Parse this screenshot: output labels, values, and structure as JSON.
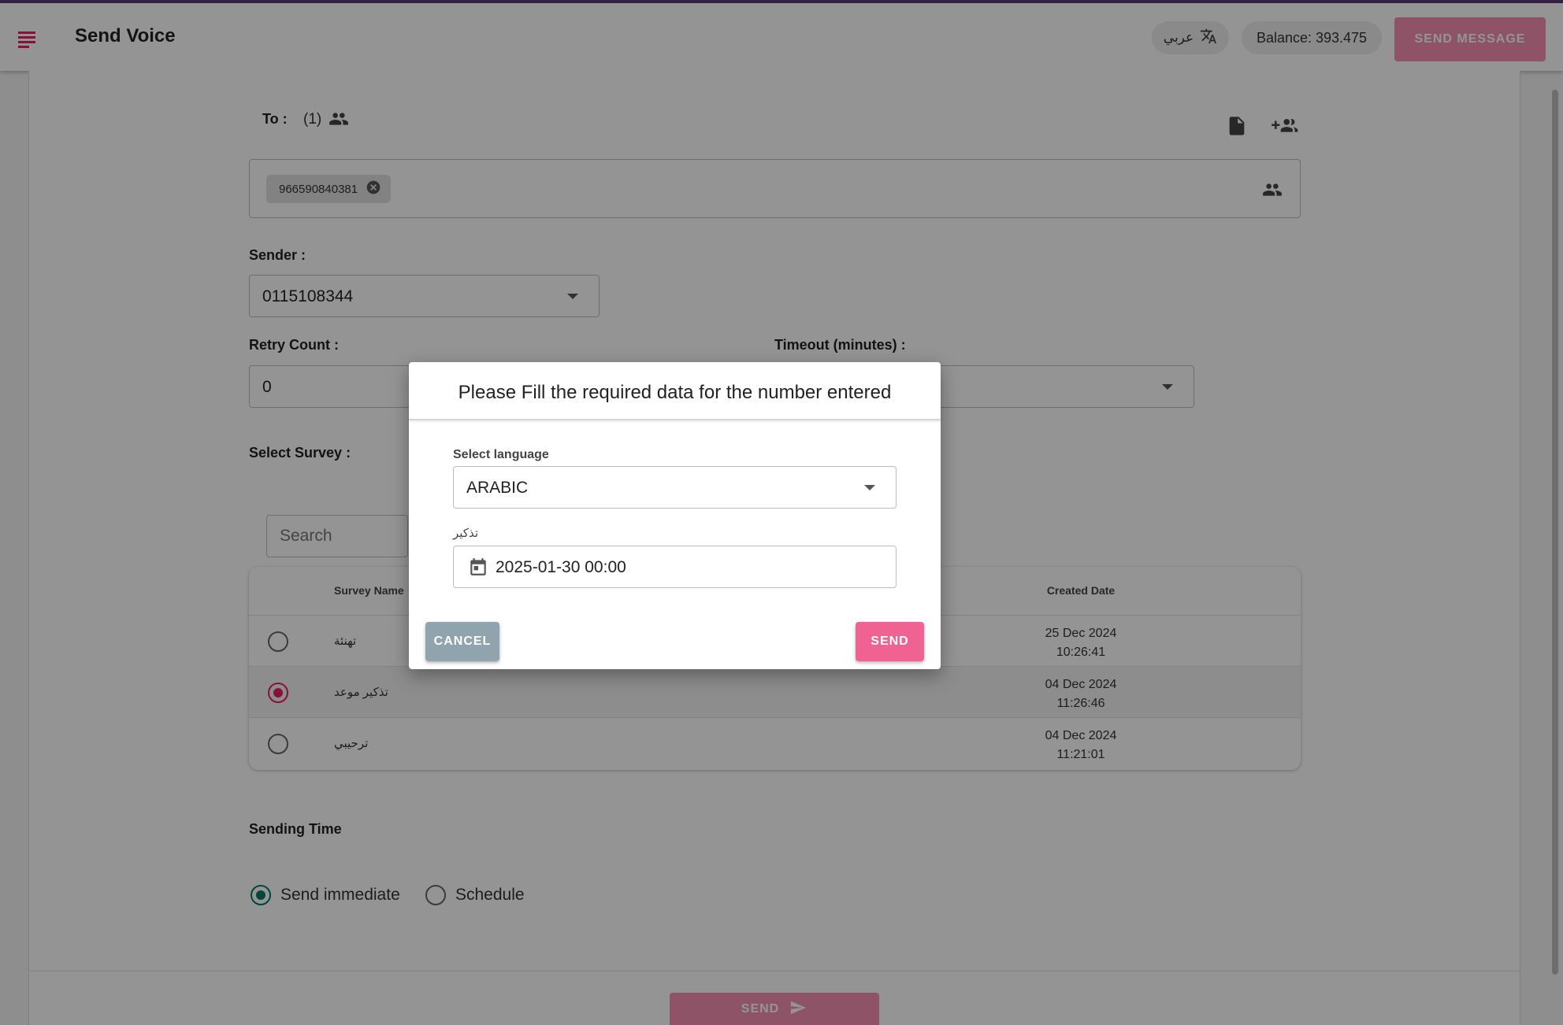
{
  "appbar": {
    "title": "Send Voice",
    "language_toggle_label": "عربي",
    "balance_text": "Balance: 393.475",
    "send_message_label": "SEND MESSAGE"
  },
  "form": {
    "to_label": "To :",
    "to_count": "(1)",
    "recipients": [
      {
        "number": "966590840381"
      }
    ],
    "sender_label": "Sender :",
    "sender_value": "0115108344",
    "retry_label": "Retry Count :",
    "retry_value": "0",
    "timeout_label": "Timeout (minutes) :",
    "survey_label": "Select Survey :",
    "search_placeholder": "Search",
    "sending_time_label": "Sending Time",
    "send_immediate_label": "Send immediate",
    "schedule_label": "Schedule",
    "send_label": "SEND"
  },
  "survey_table": {
    "columns": {
      "name": "Survey Name",
      "created": "Created Date"
    },
    "rows": [
      {
        "name": "تهنئة",
        "date": "25 Dec 2024",
        "time": "10:26:41",
        "selected": false
      },
      {
        "name": "تذكير موعد",
        "date": "04 Dec 2024",
        "time": "11:26:46",
        "selected": true
      },
      {
        "name": "ترحيبي",
        "date": "04 Dec 2024",
        "time": "11:21:01",
        "selected": false
      }
    ]
  },
  "dialog": {
    "title": "Please Fill the required data for the number entered",
    "language_label": "Select language",
    "language_value": "ARABIC",
    "reminder_label": "تذكير",
    "reminder_value": "2025-01-30 00:00",
    "cancel_label": "CANCEL",
    "send_label": "SEND"
  },
  "colors": {
    "accent": "#f48fb1",
    "accent_strong": "#f06292",
    "radio_selected": "#e91e63",
    "radio_sending": "#00796b",
    "cancel_button": "#90a4ae",
    "topline": "#5a3a6e"
  },
  "icons": [
    "menu-icon",
    "translate-icon",
    "group-icon",
    "upload-file-icon",
    "add-group-icon",
    "remove-chip-icon",
    "dropdown-caret-icon",
    "calendar-icon",
    "send-arrow-icon"
  ]
}
